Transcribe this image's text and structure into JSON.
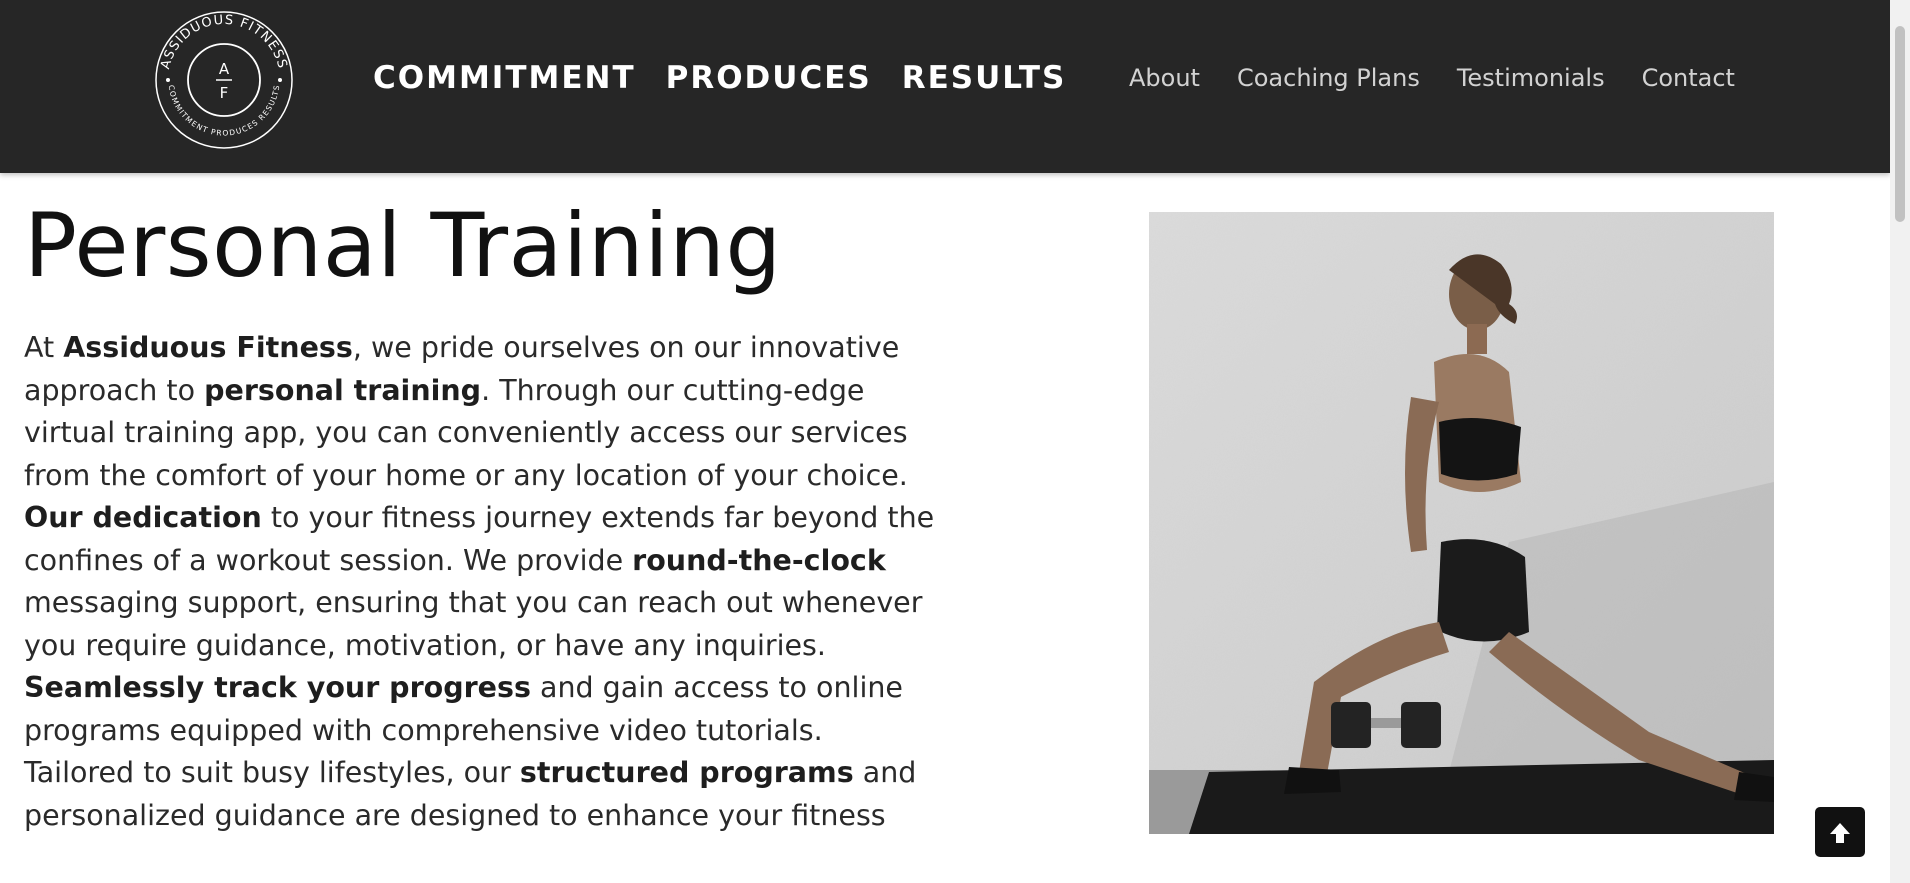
{
  "header": {
    "logo": {
      "ring_text_top": "ASSIDUOUS FITNESS",
      "ring_text_bottom": "COMMITMENT PRODUCES RESULTS",
      "monogram_top": "A",
      "monogram_bottom": "F"
    },
    "tagline": [
      "COMMITMENT",
      "PRODUCES",
      "RESULTS"
    ],
    "nav": [
      "About",
      "Coaching Plans",
      "Testimonials",
      "Contact"
    ]
  },
  "main": {
    "title": "Personal Training",
    "paragraph_lines": [
      [
        {
          "t": "At "
        },
        {
          "t": "Assiduous Fitness",
          "b": true
        },
        {
          "t": ", we pride ourselves on our innovative"
        }
      ],
      [
        {
          "t": "approach to "
        },
        {
          "t": "personal training",
          "b": true
        },
        {
          "t": ". Through our cutting-edge"
        }
      ],
      [
        {
          "t": "virtual training app, you can conveniently access our services"
        }
      ],
      [
        {
          "t": "from the comfort of your home or any location of your choice."
        }
      ],
      [
        {
          "t": "Our dedication",
          "b": true
        },
        {
          "t": " to your fitness journey extends far beyond the"
        }
      ],
      [
        {
          "t": "confines of a workout session. We provide "
        },
        {
          "t": "round-the-clock",
          "b": true
        }
      ],
      [
        {
          "t": "messaging support, ensuring that you can reach out whenever"
        }
      ],
      [
        {
          "t": "you require guidance, motivation, or have any inquiries."
        }
      ],
      [
        {
          "t": "Seamlessly track your progress",
          "b": true
        },
        {
          "t": " and gain access to online"
        }
      ],
      [
        {
          "t": "programs equipped with comprehensive video tutorials."
        }
      ],
      [
        {
          "t": "Tailored to suit busy lifestyles, our "
        },
        {
          "t": "structured programs",
          "b": true
        },
        {
          "t": " and"
        }
      ],
      [
        {
          "t": "personalized guidance are designed to enhance your fitness"
        }
      ]
    ]
  },
  "colors": {
    "header_bg": "#262626",
    "nav_text": "#d2d2d2",
    "tagline_text": "#ffffff",
    "body_text": "#2a2a2a"
  },
  "icons": {
    "back_to_top": "arrow-up-icon"
  }
}
